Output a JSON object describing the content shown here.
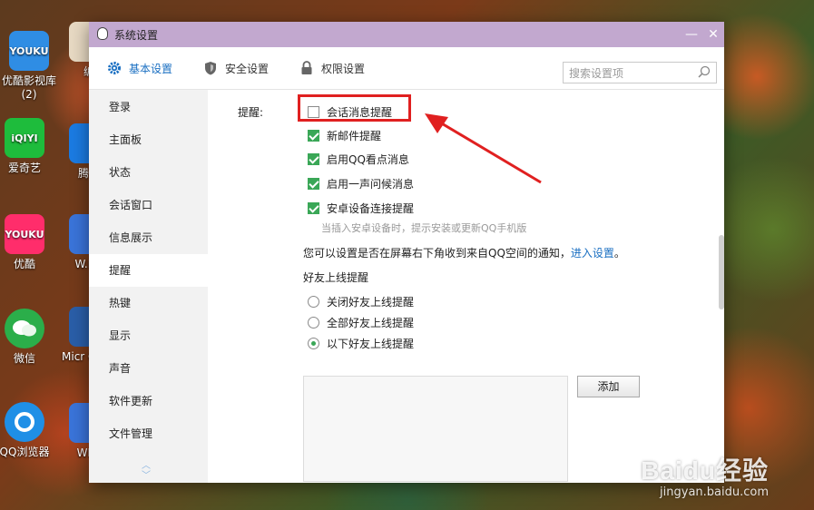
{
  "desktop": {
    "icons": [
      {
        "name": "youku-video-library",
        "tile_text": "YOUKU",
        "label": "优酷影视库",
        "label2": "(2)",
        "color": "#2f8de4"
      },
      {
        "name": "iqiyi",
        "tile_text": "iQIYI",
        "label": "爱奇艺",
        "color": "#1ebc3c"
      },
      {
        "name": "youku",
        "tile_text": "YOUKU",
        "label": "优酷",
        "color": "#ff2d6b"
      },
      {
        "name": "wechat",
        "tile_text": "",
        "label": "微信",
        "color": "#2bae4a"
      },
      {
        "name": "qq-browser",
        "tile_text": "",
        "label": "QQ浏览器",
        "color": "#1f8fe6"
      },
      {
        "name": "partial-bian",
        "tile_text": "",
        "label": "编",
        "color": "#e7d9c3"
      },
      {
        "name": "tencent-partial",
        "tile_text": "",
        "label": "腾讯",
        "color": "#1b7be2"
      },
      {
        "name": "wps-partial",
        "tile_text": "",
        "label": "W.P.S",
        "color": "#3a74d9"
      },
      {
        "name": "office-partial",
        "tile_text": "",
        "label": "Micr Office",
        "color": "#2a5ea8"
      },
      {
        "name": "wps-2-partial",
        "tile_text": "",
        "label": "WPS",
        "color": "#3a74d9"
      }
    ]
  },
  "window": {
    "title": "系统设置",
    "controls": {
      "minimize": "—",
      "close": "✕"
    },
    "tabs": [
      {
        "label": "基本设置",
        "icon": "gear-icon",
        "active": true
      },
      {
        "label": "安全设置",
        "icon": "shield-icon",
        "active": false
      },
      {
        "label": "权限设置",
        "icon": "lock-icon",
        "active": false
      }
    ],
    "search": {
      "placeholder": "搜索设置项"
    }
  },
  "sidebar": {
    "items": [
      {
        "label": "登录",
        "active": false
      },
      {
        "label": "主面板",
        "active": false
      },
      {
        "label": "状态",
        "active": false
      },
      {
        "label": "会话窗口",
        "active": false
      },
      {
        "label": "信息展示",
        "active": false
      },
      {
        "label": "提醒",
        "active": true
      },
      {
        "label": "热键",
        "active": false
      },
      {
        "label": "显示",
        "active": false
      },
      {
        "label": "声音",
        "active": false
      },
      {
        "label": "软件更新",
        "active": false
      },
      {
        "label": "文件管理",
        "active": false
      }
    ]
  },
  "content": {
    "section_label": "提醒:",
    "checkboxes": [
      {
        "label": "会话消息提醒",
        "checked": false
      },
      {
        "label": "新邮件提醒",
        "checked": true
      },
      {
        "label": "启用QQ看点消息",
        "checked": true
      },
      {
        "label": "启用一声问候消息",
        "checked": true
      },
      {
        "label": "安卓设备连接提醒",
        "checked": true
      }
    ],
    "android_hint": "当插入安卓设备时，提示安装或更新QQ手机版",
    "notice_text": "您可以设置是否在屏幕右下角收到来自QQ空间的通知，",
    "notice_link": "进入设置",
    "notice_end": "。",
    "friend_online_title": "好友上线提醒",
    "radios": [
      {
        "label": "关闭好友上线提醒",
        "checked": false
      },
      {
        "label": "全部好友上线提醒",
        "checked": false
      },
      {
        "label": "以下好友上线提醒",
        "checked": true
      }
    ],
    "add_button": "添加"
  },
  "annotation": {
    "color": "#e02020"
  },
  "watermark": {
    "logo": "Baidu经验",
    "sub": "jingyan.baidu.com"
  }
}
